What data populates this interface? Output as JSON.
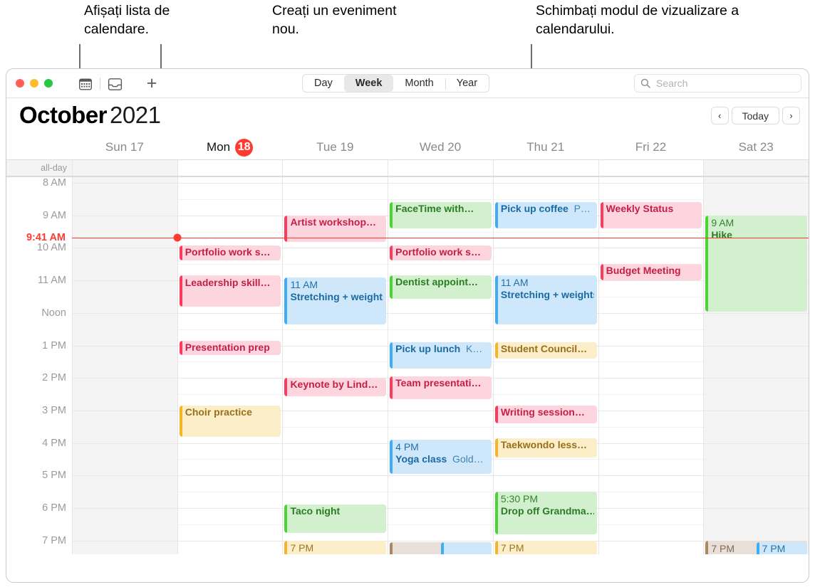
{
  "callouts": [
    {
      "id": "c1",
      "text": "Afișați lista de calendare."
    },
    {
      "id": "c2",
      "text": "Creați un eveniment nou."
    },
    {
      "id": "c3",
      "text": "Schimbați modul de vizualizare a calendarului."
    }
  ],
  "toolbar": {
    "calendars_icon": "calendar-icon",
    "inbox_icon": "inbox-icon",
    "add_label": "+",
    "views": [
      {
        "label": "Day",
        "active": false
      },
      {
        "label": "Week",
        "active": true
      },
      {
        "label": "Month",
        "active": false
      },
      {
        "label": "Year",
        "active": false
      }
    ],
    "search": {
      "placeholder": "Search",
      "value": "",
      "icon": "search-icon"
    }
  },
  "header": {
    "month": "October",
    "year": "2021",
    "prev_label": "‹",
    "today_label": "Today",
    "next_label": "›"
  },
  "days": [
    {
      "label": "Sun 17",
      "name": "Sun",
      "num": "17",
      "weekend": true,
      "today": false
    },
    {
      "label": "Mon",
      "name": "Mon",
      "num": "18",
      "weekend": false,
      "today": true
    },
    {
      "label": "Tue 19",
      "name": "Tue",
      "num": "19",
      "weekend": false,
      "today": false
    },
    {
      "label": "Wed 20",
      "name": "Wed",
      "num": "20",
      "weekend": false,
      "today": false
    },
    {
      "label": "Thu 21",
      "name": "Thu",
      "num": "21",
      "weekend": false,
      "today": false
    },
    {
      "label": "Fri 22",
      "name": "Fri",
      "num": "22",
      "weekend": false,
      "today": false
    },
    {
      "label": "Sat 23",
      "name": "Sat",
      "num": "23",
      "weekend": true,
      "today": false
    }
  ],
  "allday_label": "all-day",
  "hours": [
    {
      "label": "8 AM",
      "h": 8
    },
    {
      "label": "9 AM",
      "h": 9
    },
    {
      "label": "10 AM",
      "h": 10
    },
    {
      "label": "11 AM",
      "h": 11
    },
    {
      "label": "Noon",
      "h": 12
    },
    {
      "label": "1 PM",
      "h": 13
    },
    {
      "label": "2 PM",
      "h": 14
    },
    {
      "label": "3 PM",
      "h": 15
    },
    {
      "label": "4 PM",
      "h": 16
    },
    {
      "label": "5 PM",
      "h": 17
    },
    {
      "label": "6 PM",
      "h": 18
    },
    {
      "label": "7 PM",
      "h": 19
    }
  ],
  "now": {
    "label": "9:41 AM",
    "hour": 9.68,
    "day_index": 1,
    "color": "#ff3b30"
  },
  "colors": {
    "pink_accent": "#fb3b5c",
    "pink_bg": "#fcd5de",
    "pink_text": "#c51f47",
    "blue_accent": "#3fadf5",
    "blue_bg": "#cfe7fa",
    "blue_text": "#1a6ba4",
    "green_accent": "#4cd437",
    "green_bg": "#d2f0cd",
    "green_text": "#2b7d24",
    "yellow_accent": "#f5b528",
    "yellow_bg": "#fceec9",
    "yellow_text": "#97701a",
    "brown_accent": "#a98763",
    "brown_bg": "#e8e0d8",
    "brown_text": "#7a6350"
  },
  "events": [
    {
      "day": 1,
      "start": 9.92,
      "end": 10.42,
      "title": "Portfolio work s…",
      "color": "pink",
      "compact": true
    },
    {
      "day": 1,
      "start": 10.85,
      "end": 11.85,
      "title": "Leadership skill…",
      "color": "pink",
      "compact": false
    },
    {
      "day": 1,
      "start": 12.85,
      "end": 13.35,
      "title": "Presentation prep",
      "color": "pink",
      "compact": true
    },
    {
      "day": 1,
      "start": 14.85,
      "end": 15.85,
      "title": "Choir practice",
      "color": "yellow",
      "compact": true
    },
    {
      "day": 2,
      "start": 9.0,
      "end": 9.85,
      "title": "Artist workshop…",
      "color": "pink",
      "compact": true
    },
    {
      "day": 2,
      "start": 10.9,
      "end": 12.4,
      "time": "11 AM",
      "title": "Stretching + weights",
      "color": "blue",
      "compact": false
    },
    {
      "day": 2,
      "start": 14.0,
      "end": 14.6,
      "title": "Keynote by Lind…",
      "color": "pink",
      "compact": true
    },
    {
      "day": 2,
      "start": 17.9,
      "end": 18.8,
      "title": "Taco night",
      "color": "green",
      "compact": true
    },
    {
      "day": 2,
      "start": 19.0,
      "end": 20.0,
      "time": "7 PM",
      "title": "",
      "color": "yellow",
      "compact": false
    },
    {
      "day": 3,
      "start": 8.6,
      "end": 9.45,
      "title": "FaceTime with…",
      "color": "green",
      "compact": true
    },
    {
      "day": 3,
      "start": 9.92,
      "end": 10.42,
      "title": "Portfolio work s…",
      "color": "pink",
      "compact": true
    },
    {
      "day": 3,
      "start": 10.85,
      "end": 11.6,
      "title": "Dentist appoint…",
      "color": "green",
      "compact": true
    },
    {
      "day": 3,
      "start": 12.9,
      "end": 13.75,
      "title": "Pick up lunch",
      "loc": "K…",
      "color": "blue",
      "compact": true
    },
    {
      "day": 3,
      "start": 13.95,
      "end": 14.7,
      "title": "Team presentati…",
      "color": "pink",
      "compact": true
    },
    {
      "day": 3,
      "start": 15.9,
      "end": 17.0,
      "time": "4 PM",
      "title": "Yoga class",
      "loc": "Gold…",
      "color": "blue",
      "compact": false
    },
    {
      "day": 3,
      "start": 19.05,
      "end": 20.0,
      "time": "",
      "title": "",
      "color": "brown",
      "compact": true
    },
    {
      "day": 4,
      "start": 8.6,
      "end": 9.45,
      "title": "Pick up coffee",
      "loc": "P…",
      "color": "blue",
      "compact": true
    },
    {
      "day": 4,
      "start": 10.85,
      "end": 12.4,
      "time": "11 AM",
      "title": "Stretching + weights",
      "color": "blue",
      "compact": false
    },
    {
      "day": 4,
      "start": 12.9,
      "end": 13.45,
      "title": "Student Council…",
      "color": "yellow",
      "compact": true
    },
    {
      "day": 4,
      "start": 14.85,
      "end": 15.45,
      "title": "Writing session…",
      "color": "pink",
      "compact": true
    },
    {
      "day": 4,
      "start": 15.85,
      "end": 16.5,
      "title": "Taekwondo less…",
      "color": "yellow",
      "compact": true
    },
    {
      "day": 4,
      "start": 17.5,
      "end": 18.85,
      "time": "5:30 PM",
      "title": "Drop off Grandma…",
      "color": "green",
      "compact": false
    },
    {
      "day": 4,
      "start": 19.0,
      "end": 20.0,
      "time": "7 PM",
      "title": "",
      "color": "yellow",
      "compact": false
    },
    {
      "day": 5,
      "start": 8.6,
      "end": 9.45,
      "title": "Weekly Status",
      "color": "pink",
      "compact": true
    },
    {
      "day": 5,
      "start": 10.5,
      "end": 11.05,
      "title": "Budget Meeting",
      "color": "pink",
      "compact": true
    },
    {
      "day": 6,
      "start": 9.0,
      "end": 12.0,
      "time": "9 AM",
      "title": "Hike",
      "color": "green",
      "compact": false
    },
    {
      "day": 6,
      "start": 19.0,
      "end": 20.0,
      "time": "7 PM",
      "title": "",
      "color": "brown",
      "compact": false
    }
  ],
  "split_bottom": [
    {
      "day": 3,
      "half": "left",
      "time": "",
      "color": "brown"
    },
    {
      "day": 3,
      "half": "right",
      "time": "",
      "color": "blue"
    },
    {
      "day": 6,
      "half": "left",
      "time": "7 PM",
      "color": "brown"
    },
    {
      "day": 6,
      "half": "right",
      "time": "7 PM",
      "color": "blue"
    }
  ]
}
